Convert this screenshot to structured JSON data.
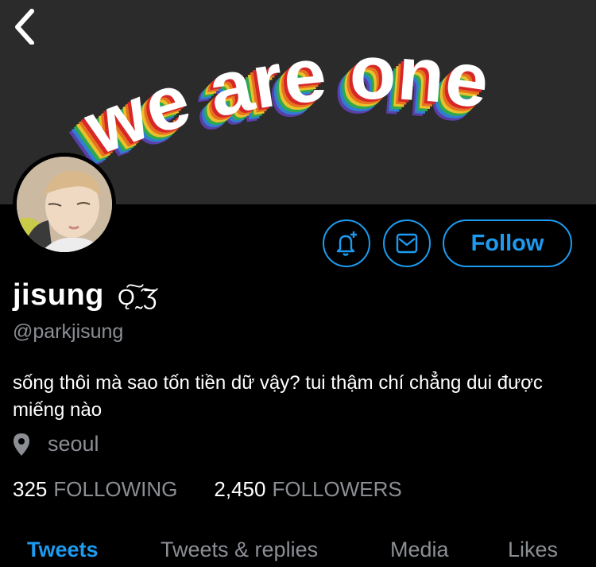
{
  "banner": {
    "headline": "we are one"
  },
  "profile": {
    "display_name": "jisung",
    "name_emoji": "Ǫ͠˷͠Ʒ",
    "handle": "@parkjisung",
    "bio": "sống thôi mà sao tốn tiền dữ vậy? tui thậm chí chẳng dui được miếng nào",
    "location": "seoul"
  },
  "actions": {
    "follow_label": "Follow"
  },
  "stats": {
    "following_count": "325",
    "following_label": "FOLLOWING",
    "followers_count": "2,450",
    "followers_label": "FOLLOWERS"
  },
  "tabs": [
    {
      "label": "Tweets",
      "active": true
    },
    {
      "label": "Tweets & replies",
      "active": false
    },
    {
      "label": "Media",
      "active": false
    },
    {
      "label": "Likes",
      "active": false
    }
  ],
  "colors": {
    "accent": "#1d9bf0",
    "secondary_text": "#8b8f94",
    "background": "#000000",
    "banner_bg": "#2b2b2b"
  },
  "icons": [
    "chevron-left-icon",
    "bell-plus-icon",
    "envelope-icon",
    "location-pin-icon"
  ]
}
